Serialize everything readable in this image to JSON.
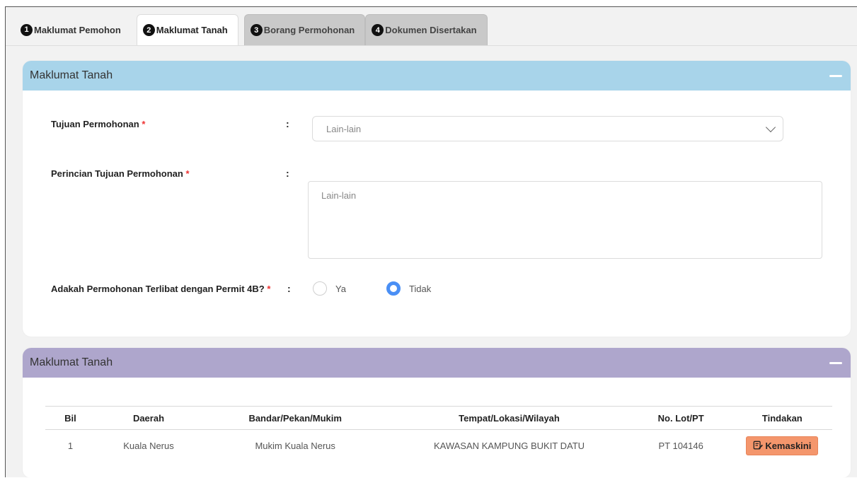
{
  "tabs": [
    {
      "num": "1",
      "label": "Maklumat Pemohon"
    },
    {
      "num": "2",
      "label": "Maklumat Tanah"
    },
    {
      "num": "3",
      "label": "Borang Permohonan"
    },
    {
      "num": "4",
      "label": "Dokumen Disertakan"
    }
  ],
  "panel1": {
    "title": "Maklumat Tanah",
    "tujuan_label": "Tujuan Permohonan",
    "tujuan_value": "Lain-lain",
    "perincian_label": "Perincian Tujuan Permohonan",
    "perincian_value": "Lain-lain",
    "permit_label": "Adakah Permohonan Terlibat dengan Permit 4B?",
    "required_mark": "*",
    "colon": ":",
    "radio_yes": "Ya",
    "radio_no": "Tidak",
    "selected_radio": "Tidak"
  },
  "panel2": {
    "title": "Maklumat Tanah",
    "headers": [
      "Bil",
      "Daerah",
      "Bandar/Pekan/Mukim",
      "Tempat/Lokasi/Wilayah",
      "No. Lot/PT",
      "Tindakan"
    ],
    "rows": [
      {
        "bil": "1",
        "daerah": "Kuala Nerus",
        "mukim": "Mukim Kuala Nerus",
        "tempat": "KAWASAN KAMPUNG BUKIT DATU",
        "lot": "PT 104146",
        "action": "Kemaskini"
      }
    ]
  },
  "colors": {
    "panel1_header": "#a8d4ea",
    "panel2_header": "#aea6cc",
    "action_button": "#f4966c",
    "radio_selected": "#4a8ff5"
  }
}
